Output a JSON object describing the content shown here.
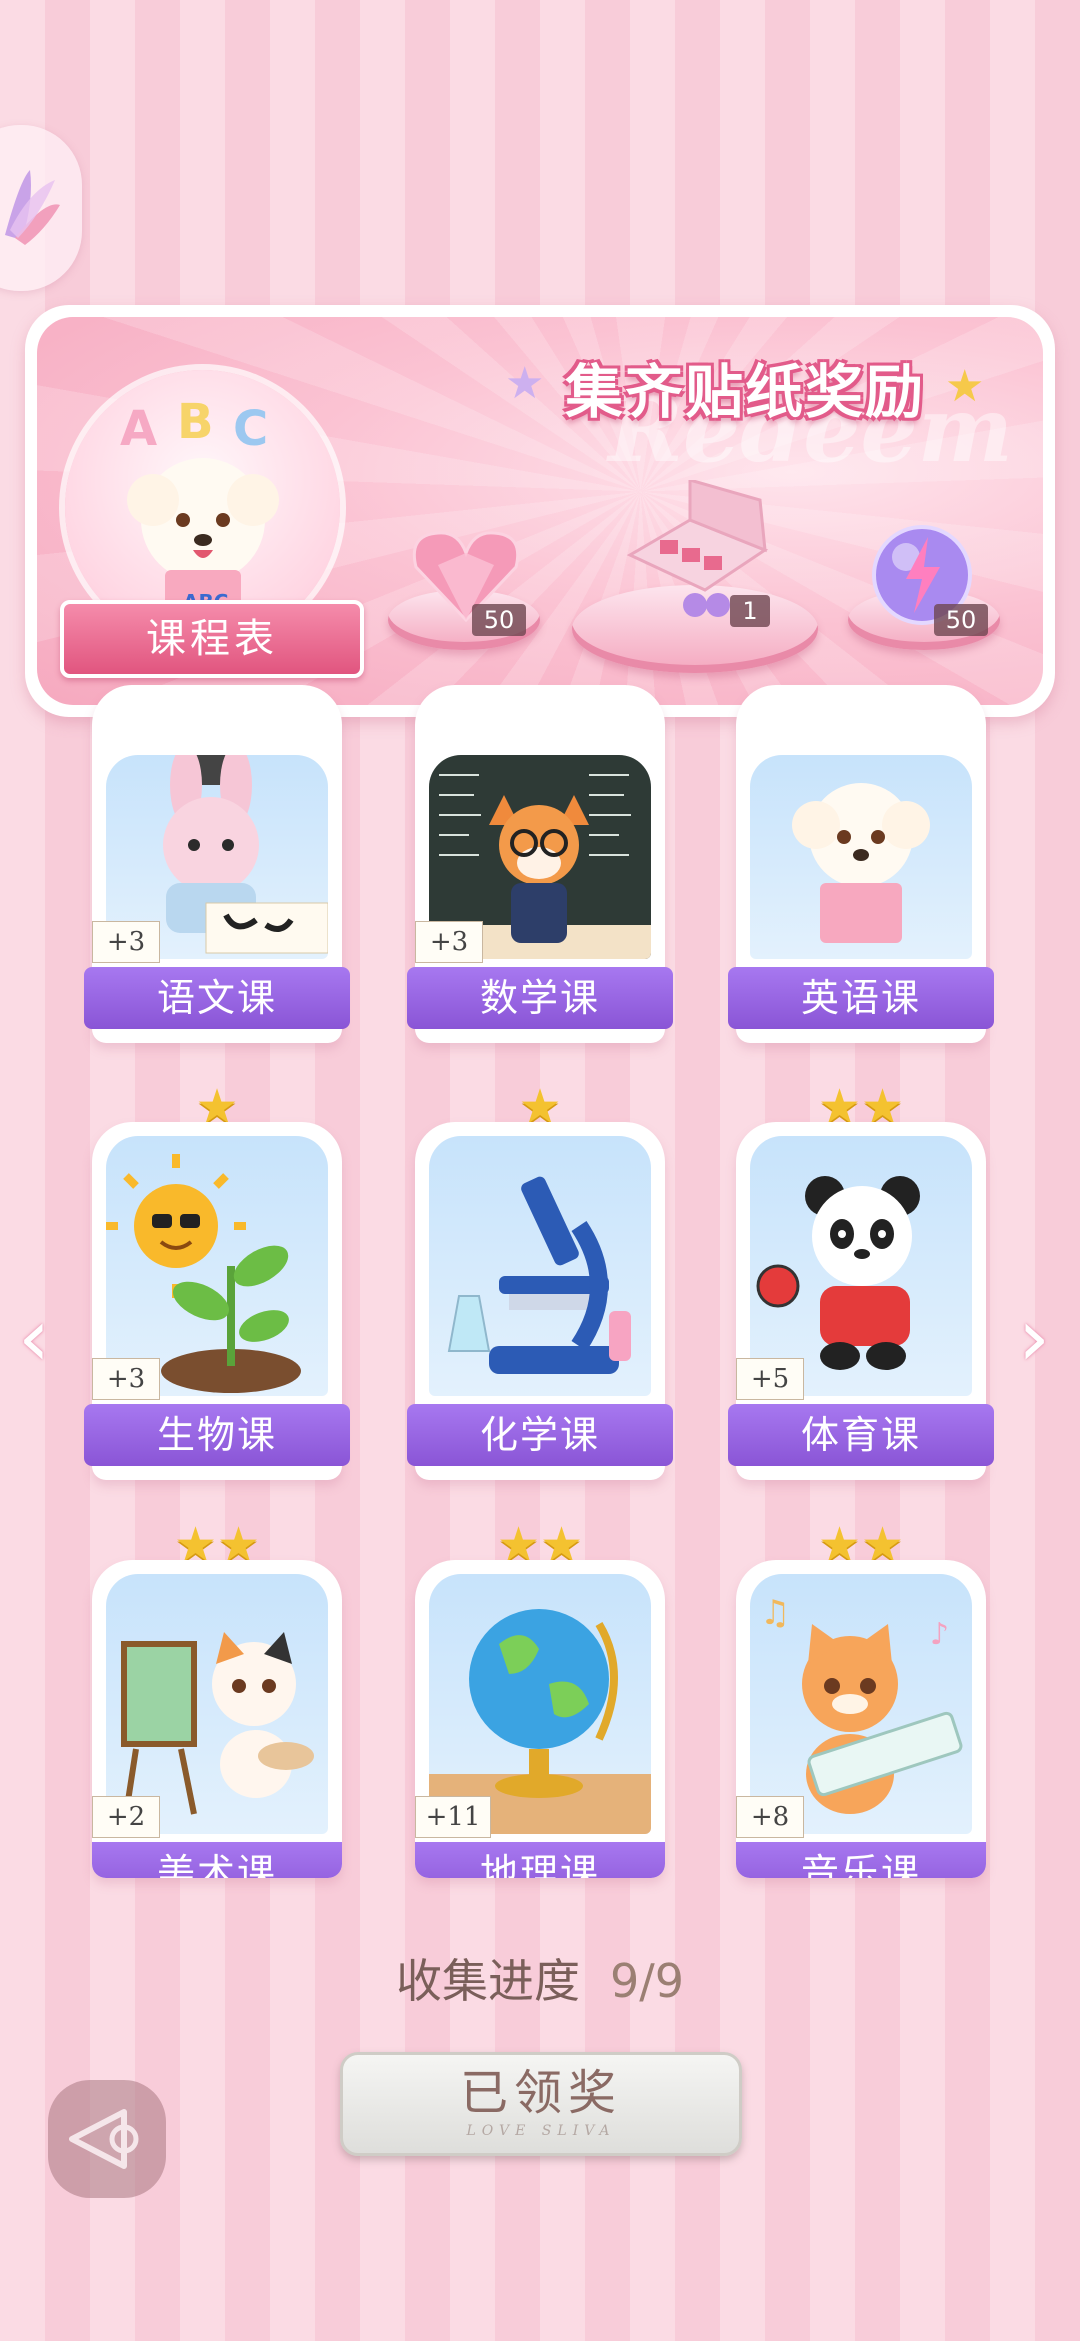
{
  "banner": {
    "title": "集齐贴纸奖励",
    "watermark": "Redeem",
    "schedule_button": "课程表",
    "avatar_text": "ABC",
    "book_text": "ABC",
    "rewards": [
      {
        "icon": "heart-gem-icon",
        "count": "50"
      },
      {
        "icon": "gift-box-icon",
        "count": "1"
      },
      {
        "icon": "lightning-orb-icon",
        "count": "50"
      }
    ]
  },
  "courses": [
    {
      "name": "语文课",
      "bonus": "+3",
      "stars": 0,
      "icon": "bunny-calligraphy-icon"
    },
    {
      "name": "数学课",
      "bonus": "+3",
      "stars": 0,
      "icon": "fox-teacher-icon"
    },
    {
      "name": "英语课",
      "bonus": "",
      "stars": 0,
      "icon": "poodle-book-icon"
    },
    {
      "name": "生物课",
      "bonus": "+3",
      "stars": 1,
      "icon": "sun-sprout-icon"
    },
    {
      "name": "化学课",
      "bonus": "",
      "stars": 1,
      "icon": "microscope-icon"
    },
    {
      "name": "体育课",
      "bonus": "+5",
      "stars": 2,
      "icon": "panda-pingpong-icon"
    },
    {
      "name": "美术课",
      "bonus": "+2",
      "stars": 2,
      "icon": "cat-painter-icon"
    },
    {
      "name": "地理课",
      "bonus": "+11",
      "stars": 2,
      "icon": "globe-icon"
    },
    {
      "name": "音乐课",
      "bonus": "+8",
      "stars": 2,
      "icon": "cat-keyboard-icon"
    }
  ],
  "progress": {
    "label": "收集进度",
    "value": "9/9"
  },
  "claim_button": {
    "label": "已领奖",
    "sub": "LOVE SLIVA"
  },
  "colors": {
    "accent": "#e25b8a",
    "label_purple": "#9563e2",
    "star": "#f4c230"
  }
}
